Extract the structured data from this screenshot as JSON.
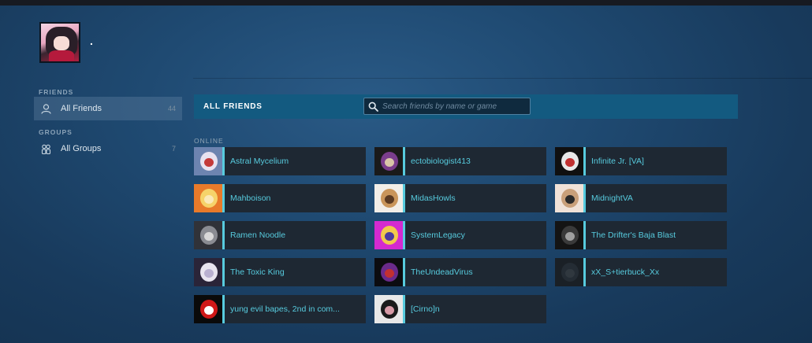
{
  "profile": {
    "name": "."
  },
  "sidebar": {
    "friends_heading": "FRIENDS",
    "groups_heading": "GROUPS",
    "items": [
      {
        "label": "All Friends",
        "count": "44",
        "icon": "person-icon"
      },
      {
        "label": "All Groups",
        "count": "7",
        "icon": "group-icon"
      }
    ]
  },
  "content": {
    "title": "ALL FRIENDS",
    "search_placeholder": "Search friends by name or game",
    "search_value": "",
    "online_heading": "ONLINE"
  },
  "colors": {
    "online_accent": "#57cbde",
    "header_bar": "#135a80",
    "card_bg": "#1e2833"
  },
  "friends": [
    {
      "name": "Astral Mycelium",
      "avatar": [
        "#6d84b0",
        "#e8e2f0",
        "#c43a3a"
      ]
    },
    {
      "name": "ectobiologist413",
      "avatar": [
        "#1a1a1a",
        "#7a3d8c",
        "#d9c6a8"
      ]
    },
    {
      "name": "Infinite Jr. [VA]",
      "avatar": [
        "#101010",
        "#e8e8e8",
        "#c03030"
      ]
    },
    {
      "name": "Mahboison",
      "avatar": [
        "#e87a2a",
        "#f6d36a",
        "#fbe9b8"
      ]
    },
    {
      "name": "MidasHowls",
      "avatar": [
        "#f2eee8",
        "#c9955a",
        "#5a3a22"
      ]
    },
    {
      "name": "MidnightVA",
      "avatar": [
        "#f0e2d8",
        "#c9a07a",
        "#2a2a2a"
      ]
    },
    {
      "name": "Ramen Noodle",
      "avatar": [
        "#303238",
        "#8a8c92",
        "#d8d8d8"
      ]
    },
    {
      "name": "SystemLegacy",
      "avatar": [
        "#d42ad0",
        "#f2c94c",
        "#4a3aa0"
      ]
    },
    {
      "name": "The Drifter's Baja Blast",
      "avatar": [
        "#141414",
        "#3a3a3a",
        "#a0a0a0"
      ]
    },
    {
      "name": "The Toxic King",
      "avatar": [
        "#2a2438",
        "#e8e4ef",
        "#b9b0d0"
      ]
    },
    {
      "name": "TheUndeadVirus",
      "avatar": [
        "#0c0c10",
        "#6a2a8a",
        "#c23030"
      ]
    },
    {
      "name": "xX_S+tierbuck_Xx",
      "avatar": [
        "#1a2026",
        "#242c34",
        "#30383f"
      ]
    },
    {
      "name": "yung evil bapes, 2nd in com...",
      "avatar": [
        "#0a0a0a",
        "#d01818",
        "#ffffff"
      ]
    },
    {
      "name": "[Cirno]n",
      "avatar": [
        "#e8e8e8",
        "#1a1a1a",
        "#d89aa6"
      ]
    }
  ]
}
